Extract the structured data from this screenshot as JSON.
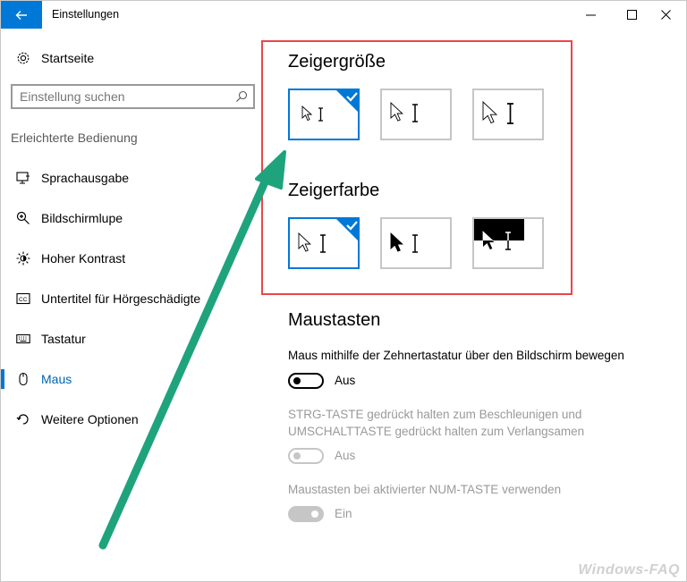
{
  "window": {
    "title": "Einstellungen",
    "controls": [
      "minimize-icon",
      "maximize-icon",
      "close-icon"
    ]
  },
  "sidebar": {
    "home_label": "Startseite",
    "search_placeholder": "Einstellung suchen",
    "section_label": "Erleichterte Bedienung",
    "items": [
      {
        "label": "Sprachausgabe",
        "icon": "narrator-icon"
      },
      {
        "label": "Bildschirmlupe",
        "icon": "magnifier-icon"
      },
      {
        "label": "Hoher Kontrast",
        "icon": "contrast-icon"
      },
      {
        "label": "Untertitel für Hörgeschädigte",
        "icon": "closed-captions-icon"
      },
      {
        "label": "Tastatur",
        "icon": "keyboard-icon"
      },
      {
        "label": "Maus",
        "icon": "mouse-icon",
        "active": true
      },
      {
        "label": "Weitere Optionen",
        "icon": "more-options-icon"
      }
    ]
  },
  "main": {
    "pointer_size": {
      "heading": "Zeigergröße",
      "options": [
        "small",
        "medium",
        "large"
      ],
      "selected": 0
    },
    "pointer_color": {
      "heading": "Zeigerfarbe",
      "options": [
        "white",
        "black",
        "inverted"
      ],
      "selected": 0
    },
    "mouse_keys": {
      "heading": "Maustasten",
      "setting1": {
        "label": "Maus mithilfe der Zehnertastatur über den Bildschirm bewegen",
        "state": "Aus"
      },
      "setting2": {
        "label_line1": "STRG-TASTE gedrückt halten zum Beschleunigen und",
        "label_line2": "UMSCHALTTASTE gedrückt halten zum Verlangsamen",
        "state": "Aus"
      },
      "setting3": {
        "label": "Maustasten bei aktivierter NUM-TASTE verwenden",
        "state": "Ein"
      }
    }
  },
  "annotation": {
    "highlight_color": "#e8474b",
    "arrow_color": "#1fa37d"
  },
  "watermark": "Windows-FAQ",
  "colors": {
    "accent": "#0078d7"
  }
}
